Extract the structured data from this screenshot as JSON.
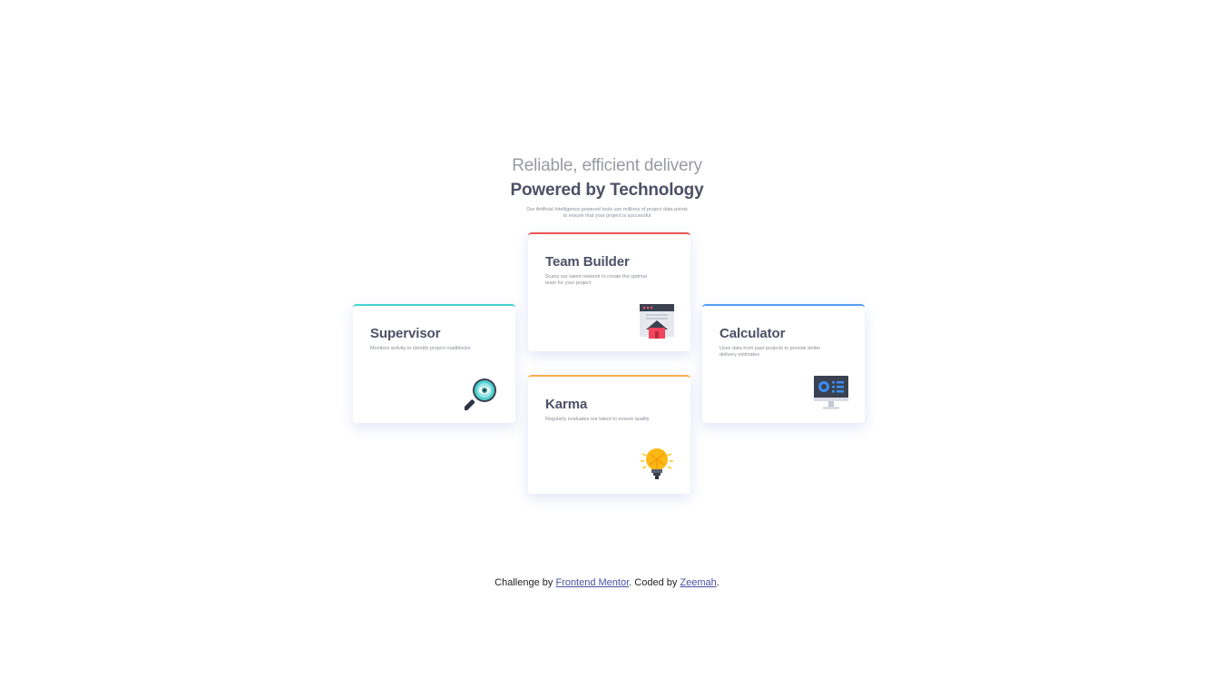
{
  "header": {
    "line1": "Reliable, efficient delivery",
    "line2": "Powered by Technology",
    "description": "Our Artificial Intelligence powered tools use millions of project data points to ensure that your project is successful"
  },
  "cards": {
    "supervisor": {
      "title": "Supervisor",
      "text": "Monitors activity to identify project roadblocks",
      "icon": "supervisor-icon"
    },
    "team_builder": {
      "title": "Team Builder",
      "text": "Scans our talent network to create the optimal team for your project",
      "icon": "team-builder-icon"
    },
    "karma": {
      "title": "Karma",
      "text": "Regularly evaluates our talent to ensure quality",
      "icon": "karma-icon"
    },
    "calculator": {
      "title": "Calculator",
      "text": "Uses data from past projects to provide better delivery estimates",
      "icon": "calculator-icon"
    }
  },
  "footer": {
    "prefix": "Challenge by ",
    "link1": "Frontend Mentor",
    "middle": ". Coded by ",
    "link2": "Zeemah",
    "suffix": "."
  },
  "colors": {
    "cyan": "#44d3d2",
    "red": "#ea5454",
    "orange": "#fcae4a",
    "blue": "#549ef2",
    "text_dark": "#4d5066",
    "text_grey": "#8a8d9a"
  }
}
